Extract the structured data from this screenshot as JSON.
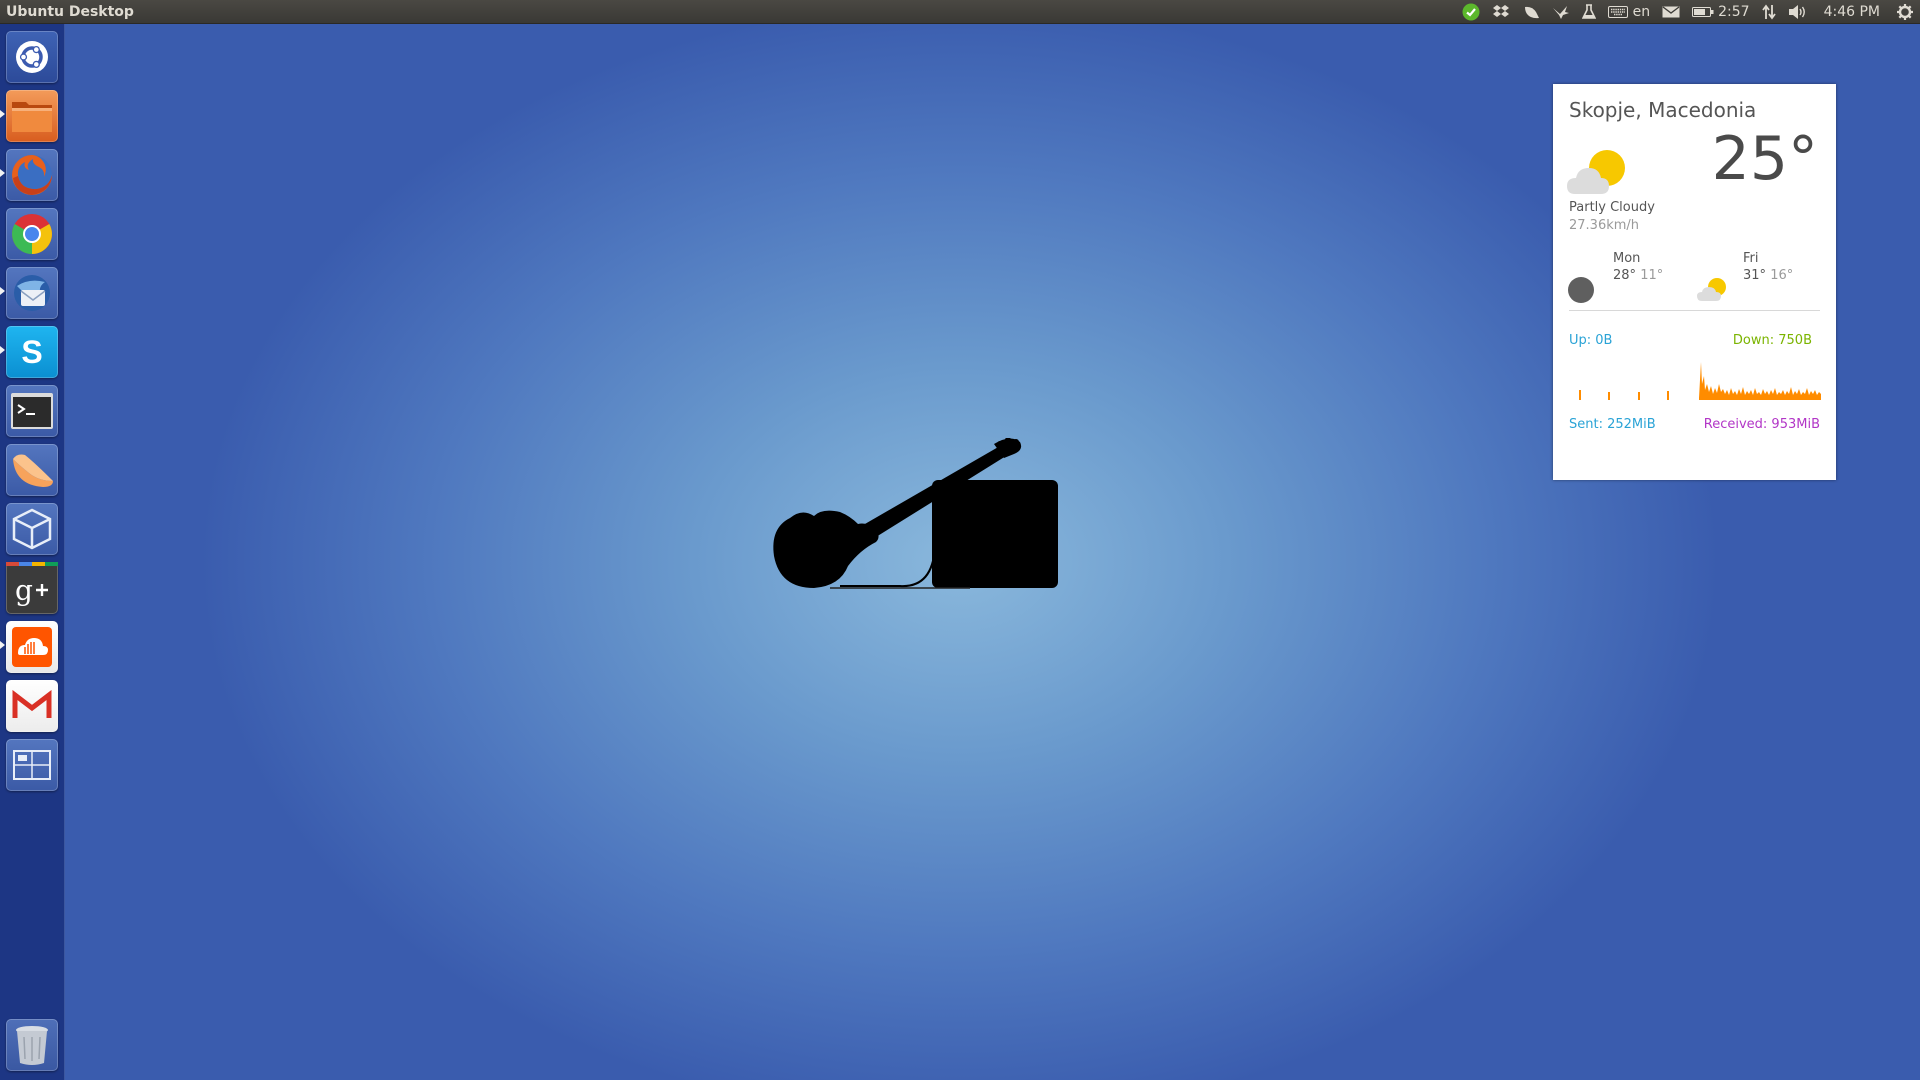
{
  "panel": {
    "title": "Ubuntu Desktop",
    "keyboard_layout": "en",
    "battery_time": "2:57",
    "clock": "4:46 PM"
  },
  "launcher": {
    "items": [
      {
        "name": "dash-home",
        "icon": "ubuntu-logo-icon",
        "running": false
      },
      {
        "name": "files",
        "icon": "folder-icon",
        "running": true
      },
      {
        "name": "firefox",
        "icon": "firefox-icon",
        "running": true
      },
      {
        "name": "chrome",
        "icon": "chrome-icon",
        "running": false
      },
      {
        "name": "thunderbird",
        "icon": "thunderbird-icon",
        "running": true
      },
      {
        "name": "skype",
        "icon": "skype-icon",
        "running": true
      },
      {
        "name": "terminal",
        "icon": "terminal-icon",
        "running": false
      },
      {
        "name": "clementine",
        "icon": "clementine-icon",
        "running": false
      },
      {
        "name": "virtualbox",
        "icon": "virtualbox-icon",
        "running": false
      },
      {
        "name": "google-plus",
        "icon": "google-plus-icon",
        "running": false
      },
      {
        "name": "soundcloud",
        "icon": "soundcloud-icon",
        "running": true
      },
      {
        "name": "gmail",
        "icon": "gmail-icon",
        "running": false
      },
      {
        "name": "workspace-switcher",
        "icon": "workspace-switcher-icon",
        "running": false
      }
    ],
    "trash_icon": "trash-icon"
  },
  "weather": {
    "location": "Skopje, Macedonia",
    "temperature": "25°",
    "condition": "Partly Cloudy",
    "wind": "27.36km/h",
    "forecast": [
      {
        "day": "Mon",
        "high": "28°",
        "low": "11°",
        "icon": "moon-icon"
      },
      {
        "day": "Fri",
        "high": "31°",
        "low": "16°",
        "icon": "partly-cloudy-icon"
      }
    ]
  },
  "network": {
    "up": "Up: 0B",
    "down": "Down: 750B",
    "sent": "Sent: 252MiB",
    "received": "Received: 953MiB",
    "up_color": "#2aa3d6",
    "down_color": "#7bb400",
    "sent_color": "#2aa3d6",
    "received_color": "#b236c7",
    "graph_color": "#ff8c00"
  },
  "colors": {
    "panel_bg": "#3c3b37",
    "launcher_bg": "#1c3480",
    "desktop_center": "#8ab8dc",
    "desktop_edge": "#3a5cae"
  }
}
